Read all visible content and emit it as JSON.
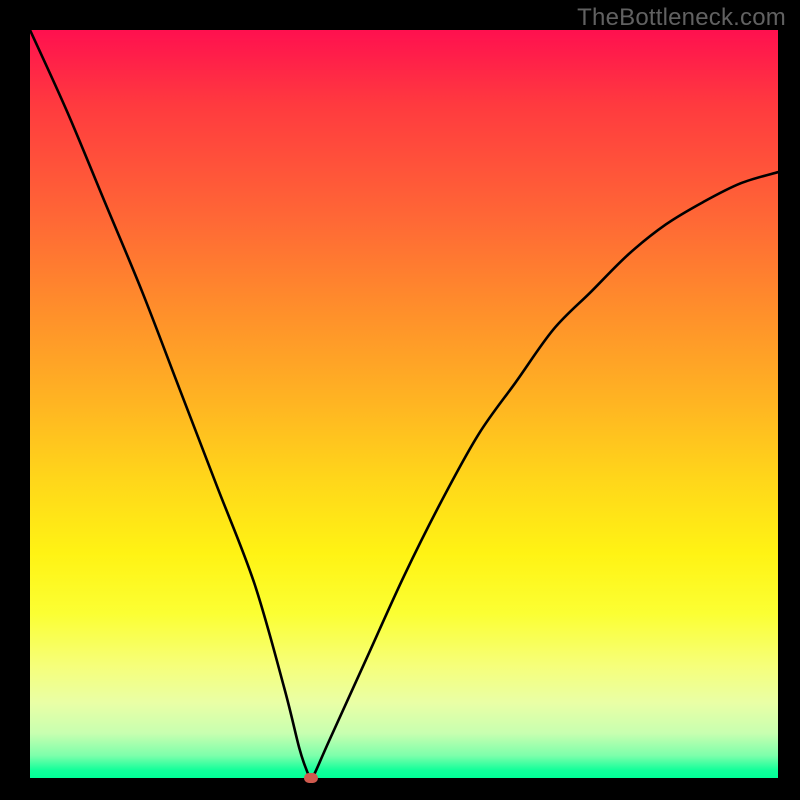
{
  "watermark": "TheBottleneck.com",
  "chart_data": {
    "type": "line",
    "title": "",
    "xlabel": "",
    "ylabel": "",
    "xlim": [
      0,
      100
    ],
    "ylim": [
      0,
      100
    ],
    "grid": false,
    "legend": false,
    "series": [
      {
        "name": "bottleneck-curve",
        "x": [
          0,
          5,
          10,
          15,
          20,
          25,
          30,
          34,
          36,
          37,
          37.5,
          38,
          40,
          45,
          50,
          55,
          60,
          65,
          70,
          75,
          80,
          85,
          90,
          95,
          100
        ],
        "y": [
          100,
          89,
          77,
          65,
          52,
          39,
          26,
          12,
          4,
          1,
          0,
          0.5,
          5,
          16,
          27,
          37,
          46,
          53,
          60,
          65,
          70,
          74,
          77,
          79.5,
          81
        ]
      }
    ],
    "marker": {
      "x": 37.5,
      "y": 0,
      "color": "#cf5a4e"
    },
    "background_gradient": {
      "top": "#ff104f",
      "bottom": "#00ff97"
    },
    "frame_color": "#000000"
  }
}
